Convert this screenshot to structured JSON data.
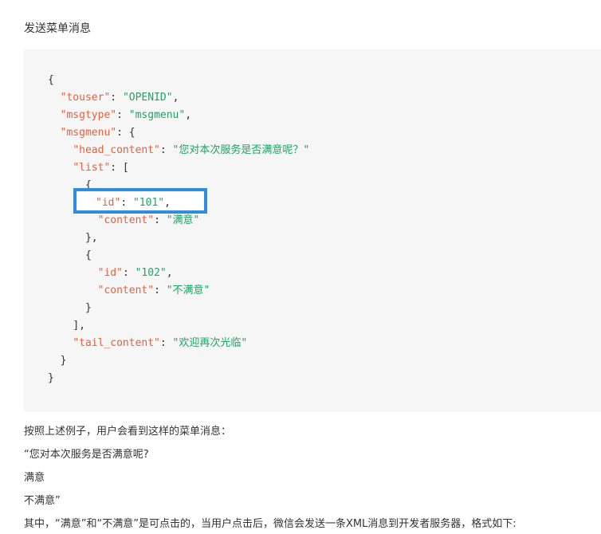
{
  "heading": "发送菜单消息",
  "code": {
    "lines": [
      {
        "indent": "",
        "parts": [
          {
            "t": "{",
            "c": "punc"
          }
        ]
      },
      {
        "indent": "  ",
        "parts": [
          {
            "t": "\"touser\"",
            "c": "key"
          },
          {
            "t": ": ",
            "c": "punc"
          },
          {
            "t": "\"OPENID\"",
            "c": "str"
          },
          {
            "t": ",",
            "c": "punc"
          }
        ]
      },
      {
        "indent": "  ",
        "parts": [
          {
            "t": "\"msgtype\"",
            "c": "key"
          },
          {
            "t": ": ",
            "c": "punc"
          },
          {
            "t": "\"msgmenu\"",
            "c": "str"
          },
          {
            "t": ",",
            "c": "punc"
          }
        ]
      },
      {
        "indent": "  ",
        "parts": [
          {
            "t": "\"msgmenu\"",
            "c": "key"
          },
          {
            "t": ": {",
            "c": "punc"
          }
        ]
      },
      {
        "indent": "    ",
        "parts": [
          {
            "t": "\"head_content\"",
            "c": "key"
          },
          {
            "t": ": ",
            "c": "punc"
          },
          {
            "t": "\"您对本次服务是否满意呢？\"",
            "c": "str"
          }
        ]
      },
      {
        "indent": "    ",
        "parts": [
          {
            "t": "\"list\"",
            "c": "key"
          },
          {
            "t": ": [",
            "c": "punc"
          }
        ]
      },
      {
        "indent": "      ",
        "parts": [
          {
            "t": "{",
            "c": "punc"
          }
        ]
      },
      {
        "indent": "",
        "parts": []
      },
      {
        "indent": "        ",
        "parts": [
          {
            "t": "\"content\"",
            "c": "key"
          },
          {
            "t": ": ",
            "c": "punc"
          },
          {
            "t": "\"满意\"",
            "c": "str"
          }
        ]
      },
      {
        "indent": "      ",
        "parts": [
          {
            "t": "},",
            "c": "punc"
          }
        ]
      },
      {
        "indent": "      ",
        "parts": [
          {
            "t": "{",
            "c": "punc"
          }
        ]
      },
      {
        "indent": "        ",
        "parts": [
          {
            "t": "\"id\"",
            "c": "key"
          },
          {
            "t": ": ",
            "c": "punc"
          },
          {
            "t": "\"102\"",
            "c": "str"
          },
          {
            "t": ",",
            "c": "punc"
          }
        ]
      },
      {
        "indent": "        ",
        "parts": [
          {
            "t": "\"content\"",
            "c": "key"
          },
          {
            "t": ": ",
            "c": "punc"
          },
          {
            "t": "\"不满意\"",
            "c": "str"
          }
        ]
      },
      {
        "indent": "      ",
        "parts": [
          {
            "t": "}",
            "c": "punc"
          }
        ]
      },
      {
        "indent": "    ",
        "parts": [
          {
            "t": "],",
            "c": "punc"
          }
        ]
      },
      {
        "indent": "    ",
        "parts": [
          {
            "t": "\"tail_content\"",
            "c": "key"
          },
          {
            "t": ": ",
            "c": "punc"
          },
          {
            "t": "\"欢迎再次光临\"",
            "c": "str"
          }
        ]
      },
      {
        "indent": "  ",
        "parts": [
          {
            "t": "}",
            "c": "punc"
          }
        ]
      },
      {
        "indent": "",
        "parts": [
          {
            "t": "}",
            "c": "punc"
          }
        ]
      }
    ],
    "highlighted": {
      "key": "\"id\"",
      "sep": ": ",
      "value": "\"101\"",
      "comma": ","
    }
  },
  "paragraphs": [
    "按照上述例子，用户会看到这样的菜单消息：",
    "“您对本次服务是否满意呢?",
    "满意",
    "不满意”",
    "其中，“满意”和“不满意”是可点击的，当用户点击后，微信会发送一条XML消息到开发者服务器，格式如下:"
  ],
  "colors": {
    "key": "#e8603c",
    "string": "#1fa463",
    "highlight_border": "#2f8ce2",
    "code_bg": "#f6f6f6"
  }
}
